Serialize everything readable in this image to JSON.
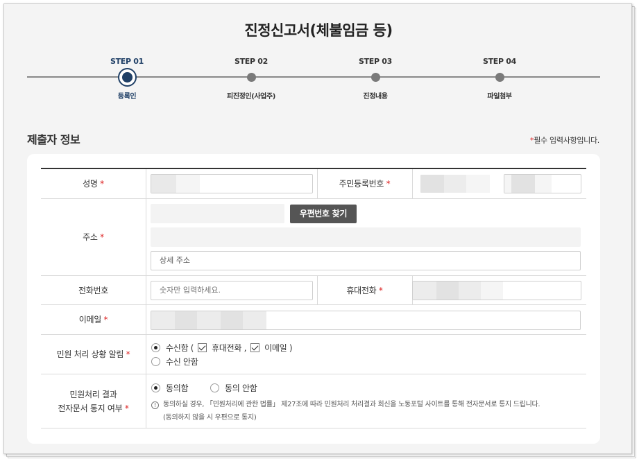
{
  "page": {
    "title": "진정신고서(체불임금 등)"
  },
  "steps": [
    {
      "num": "STEP 01",
      "label": "등록인",
      "active": true
    },
    {
      "num": "STEP 02",
      "label": "피진정인(사업주)",
      "active": false
    },
    {
      "num": "STEP 03",
      "label": "진정내용",
      "active": false
    },
    {
      "num": "STEP 04",
      "label": "파일첨부",
      "active": false
    }
  ],
  "section": {
    "title": "제출자 정보",
    "required_mark": "*",
    "required_text": "필수 입력사항입니다."
  },
  "form": {
    "required_mark": "*",
    "name": {
      "label": "성명",
      "value": ""
    },
    "rrn": {
      "label": "주민등록번호",
      "value": ""
    },
    "address": {
      "label": "주소",
      "zip_value": "",
      "search_button": "우편번호 찾기",
      "base_value": "",
      "detail_placeholder": "상세 주소"
    },
    "phone": {
      "label": "전화번호",
      "placeholder": "숫자만 입력하세요."
    },
    "mobile": {
      "label": "휴대전화",
      "value": ""
    },
    "email": {
      "label": "이메일",
      "value": ""
    },
    "notify": {
      "label": "민원 처리 상황 알림",
      "receive_label": "수신함 (",
      "mobile_label": "휴대전화 ,",
      "email_label": "이메일 )",
      "mobile_checked": true,
      "email_checked": true,
      "no_receive_label": "수신 안함",
      "selected": "receive"
    },
    "consent": {
      "label_line1": "민원처리 결과",
      "label_line2": "전자문서 통지 여부",
      "agree_label": "동의함",
      "disagree_label": "동의 안함",
      "selected": "agree",
      "note_line1": "동의하실 경우, 「민원처리에 관한 법률」 제27조에 따라 민원처리 처리결과 회신을 노동포털 사이트를 통해 전자문서로 통지 드립니다.",
      "note_line2": "(동의하지 않을 시 우편으로 통지)"
    }
  }
}
